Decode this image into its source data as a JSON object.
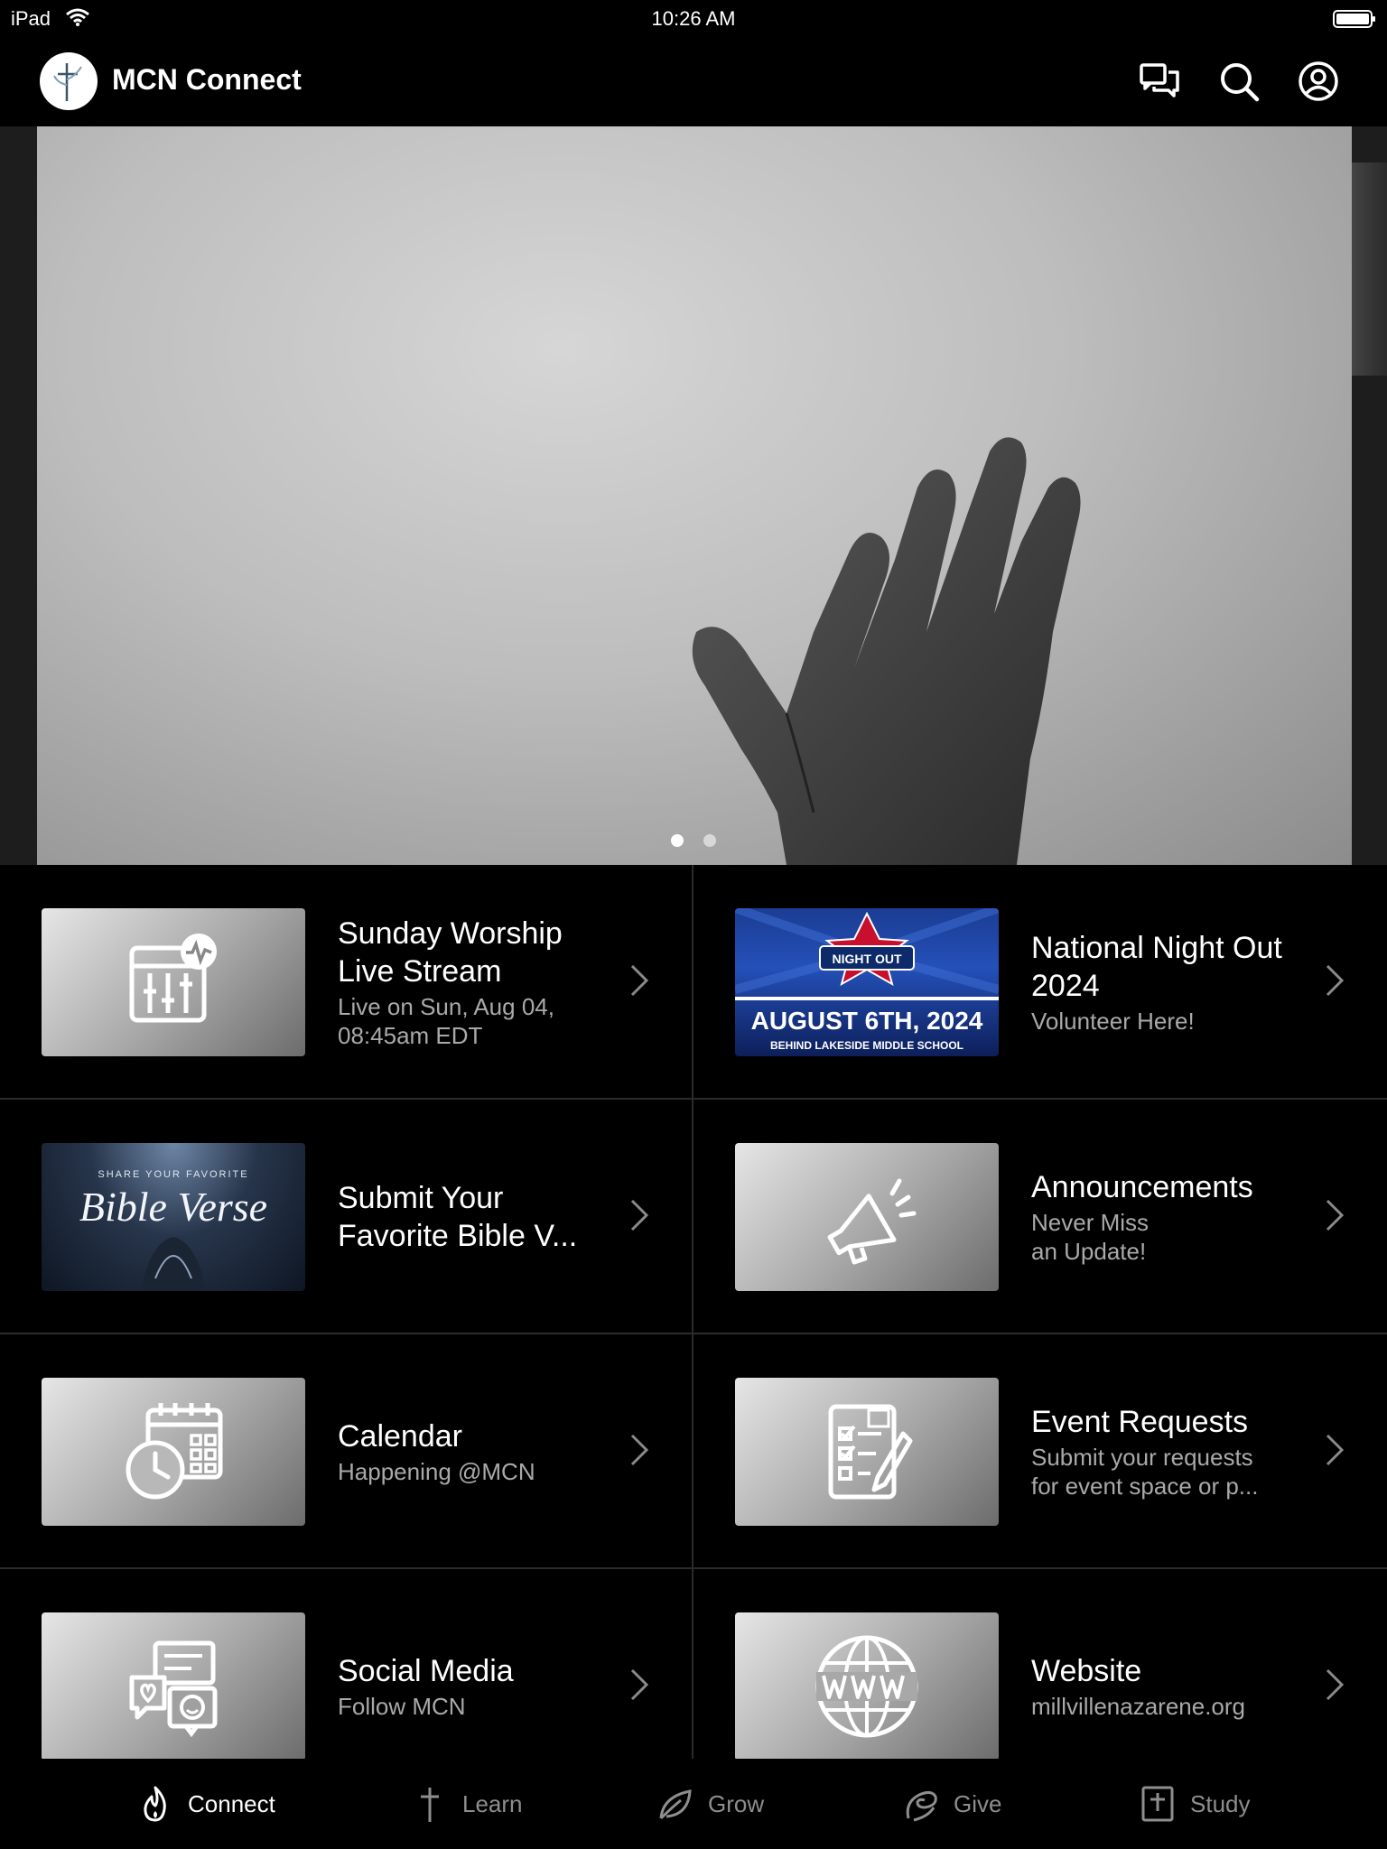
{
  "status_bar": {
    "device": "iPad",
    "time": "10:26 AM"
  },
  "header": {
    "title": "MCN Connect"
  },
  "hero": {
    "slide_count": 2,
    "active_index": 0
  },
  "nno_banner": {
    "badge_text": "NIGHT OUT",
    "date_text": "AUGUST 6TH, 2024",
    "location_text": "BEHIND LAKESIDE MIDDLE SCHOOL"
  },
  "bible_banner": {
    "small_text": "SHARE YOUR FAVORITE",
    "script_text": "Bible Verse"
  },
  "tiles": [
    {
      "title": "Sunday Worship Live Stream",
      "subtitle": "Live on Sun, Aug 04,\n08:45am EDT",
      "icon": "live-stream-icon"
    },
    {
      "title": "National Night Out 2024",
      "subtitle": "Volunteer Here!",
      "icon": "night-out-banner"
    },
    {
      "title": "Submit Your Favorite Bible V...",
      "subtitle": "",
      "icon": "bible-verse-banner"
    },
    {
      "title": "Announcements",
      "subtitle": "Never Miss\nan Update!",
      "icon": "megaphone-icon"
    },
    {
      "title": "Calendar",
      "subtitle": "Happening @MCN",
      "icon": "calendar-clock-icon"
    },
    {
      "title": "Event Requests",
      "subtitle": "Submit your requests\nfor event space or p...",
      "icon": "checklist-icon"
    },
    {
      "title": "Social Media",
      "subtitle": "Follow MCN",
      "icon": "social-chat-icon"
    },
    {
      "title": "Website",
      "subtitle": "millvillenazarene.org",
      "icon": "globe-www-icon"
    }
  ],
  "tabs": [
    {
      "label": "Connect",
      "icon": "flame-icon",
      "active": true
    },
    {
      "label": "Learn",
      "icon": "cross-icon",
      "active": false
    },
    {
      "label": "Grow",
      "icon": "leaf-icon",
      "active": false
    },
    {
      "label": "Give",
      "icon": "give-icon",
      "active": false
    },
    {
      "label": "Study",
      "icon": "bible-icon",
      "active": false
    }
  ],
  "colors": {
    "background": "#000000",
    "divider": "#2b2b2b",
    "subtitle": "#a9a9a9",
    "tab_inactive": "#8e8e8e"
  }
}
